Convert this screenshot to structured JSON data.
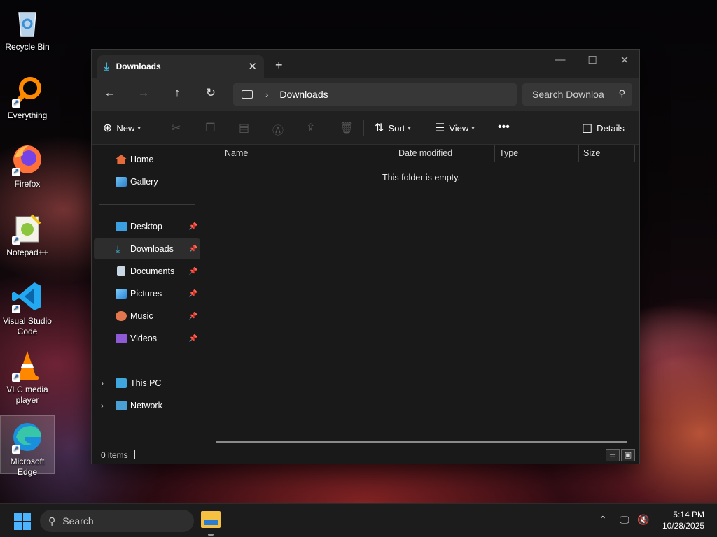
{
  "desktop": {
    "icons": [
      {
        "label": "Recycle Bin",
        "icon": "recycle-bin-icon"
      },
      {
        "label": "Everything",
        "icon": "everything-search-icon"
      },
      {
        "label": "Firefox",
        "icon": "firefox-icon"
      },
      {
        "label": "Notepad++",
        "icon": "notepad-plus-plus-icon"
      },
      {
        "label": "Visual Studio Code",
        "icon": "vscode-icon"
      },
      {
        "label": "VLC media player",
        "icon": "vlc-icon"
      },
      {
        "label": "Microsoft Edge",
        "icon": "edge-icon"
      }
    ]
  },
  "window": {
    "tab_title": "Downloads",
    "address": {
      "segments": [
        "Downloads"
      ]
    },
    "search_placeholder": "Search Downloa",
    "commands": {
      "new": "New",
      "sort": "Sort",
      "view": "View",
      "details": "Details"
    },
    "sidebar": {
      "top": [
        {
          "label": "Home",
          "icon": "home-icon"
        },
        {
          "label": "Gallery",
          "icon": "gallery-icon"
        }
      ],
      "pinned": [
        {
          "label": "Desktop",
          "icon": "desktop-folder-icon"
        },
        {
          "label": "Downloads",
          "icon": "downloads-icon"
        },
        {
          "label": "Documents",
          "icon": "documents-icon"
        },
        {
          "label": "Pictures",
          "icon": "pictures-icon"
        },
        {
          "label": "Music",
          "icon": "music-icon"
        },
        {
          "label": "Videos",
          "icon": "videos-icon"
        }
      ],
      "bottom": [
        {
          "label": "This PC",
          "icon": "this-pc-icon"
        },
        {
          "label": "Network",
          "icon": "network-icon"
        }
      ]
    },
    "columns": [
      "Name",
      "Date modified",
      "Type",
      "Size"
    ],
    "empty_message": "This folder is empty.",
    "status": "0 items"
  },
  "taskbar": {
    "search_label": "Search",
    "time": "5:14 PM",
    "date": "10/28/2025"
  },
  "colors": {
    "accent": "#4cb3ff",
    "window_bg": "#191919",
    "navbar_bg": "#2b2b2b"
  }
}
